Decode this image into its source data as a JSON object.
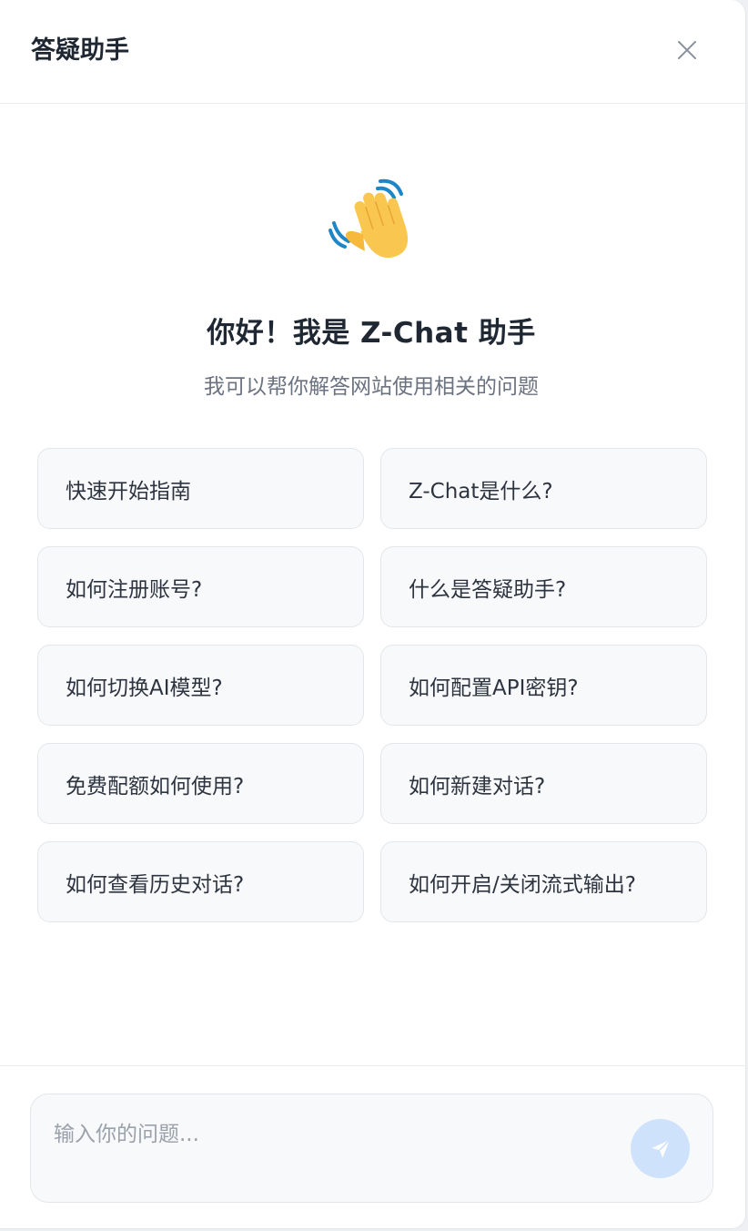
{
  "header": {
    "title": "答疑助手",
    "close_icon": "close-icon"
  },
  "welcome": {
    "icon": "waving-hand-icon",
    "title": "你好！我是 Z-Chat 助手",
    "subtitle": "我可以帮你解答网站使用相关的问题"
  },
  "questions": [
    "快速开始指南",
    "Z-Chat是什么?",
    "如何注册账号?",
    "什么是答疑助手?",
    "如何切换AI模型?",
    "如何配置API密钥?",
    "免费配额如何使用?",
    "如何新建对话?",
    "如何查看历史对话?",
    "如何开启/关闭流式输出?"
  ],
  "composer": {
    "placeholder": "输入你的问题...",
    "value": "",
    "send_icon": "send-icon"
  },
  "colors": {
    "send_button_bg": "#cfe2fb",
    "send_icon": "#ffffff",
    "text_primary": "#1f2733",
    "text_secondary": "#6b7280"
  }
}
